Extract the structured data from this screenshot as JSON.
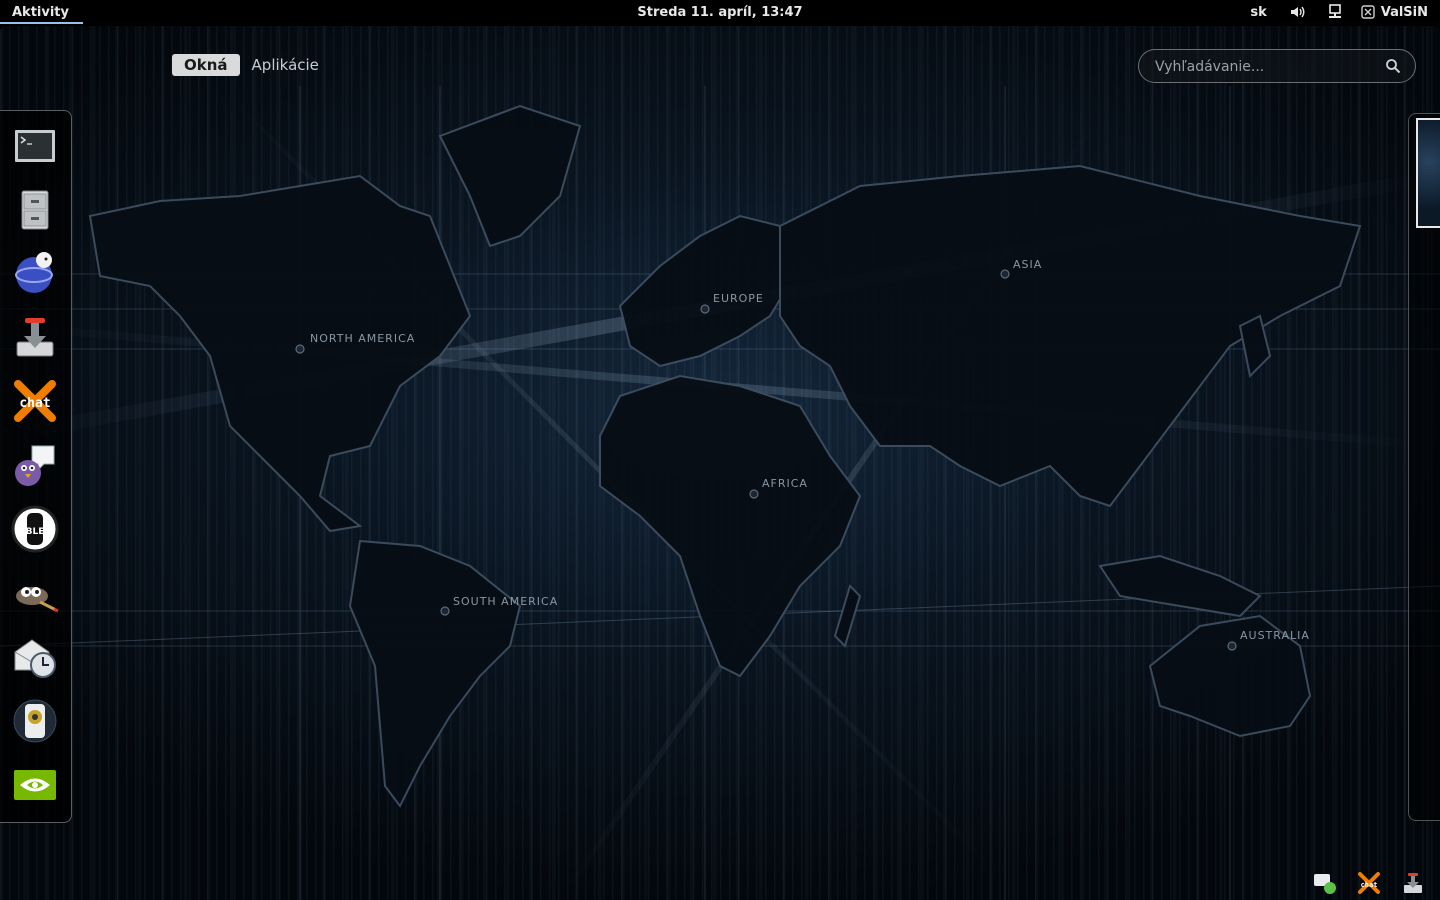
{
  "topbar": {
    "activities_label": "Aktivity",
    "clock": "Streda 11. apríl, 13:47",
    "keyboard_layout": "sk",
    "username": "ValSiN"
  },
  "overview": {
    "tabs": [
      {
        "label": "Okná",
        "active": true
      },
      {
        "label": "Aplikácie",
        "active": false
      }
    ],
    "search_placeholder": "Vyhľadávanie..."
  },
  "wallpaper_labels": {
    "north_america": "NORTH AMERICA",
    "europe": "EUROPE",
    "asia": "ASIA",
    "africa": "AFRICA",
    "south_america": "SOUTH AMERICA",
    "australia": "AUSTRALIA"
  },
  "dash_apps": [
    "terminal-icon",
    "file-cabinet-icon",
    "pidgin-like-globe-icon",
    "download-manager-icon",
    "xchat-icon",
    "pidgin-icon",
    "bleachbit-icon",
    "gimp-icon",
    "mail-scheduler-icon",
    "audio-player-icon",
    "nvidia-icon"
  ],
  "message_tray": [
    "chat-notification-icon",
    "xchat-tray-icon",
    "download-tray-icon"
  ],
  "colors": {
    "accent": "#9cc1e6",
    "tab_active_bg": "#d8dadc",
    "nvidia_green": "#76b900",
    "xchat_orange": "#f07d00"
  }
}
